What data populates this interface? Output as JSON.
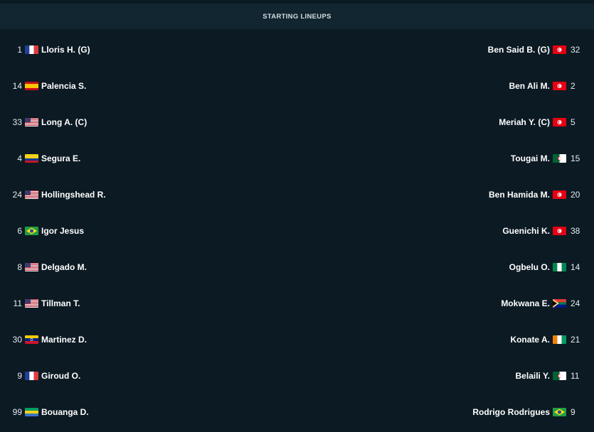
{
  "header": {
    "title": "STARTING LINEUPS"
  },
  "lineups": {
    "home": [
      {
        "number": "1",
        "name": "Lloris H. (G)",
        "flag": "france"
      },
      {
        "number": "14",
        "name": "Palencia S.",
        "flag": "spain"
      },
      {
        "number": "33",
        "name": "Long A. (C)",
        "flag": "usa"
      },
      {
        "number": "4",
        "name": "Segura E.",
        "flag": "colombia"
      },
      {
        "number": "24",
        "name": "Hollingshead R.",
        "flag": "usa"
      },
      {
        "number": "6",
        "name": "Igor Jesus",
        "flag": "brazil"
      },
      {
        "number": "8",
        "name": "Delgado M.",
        "flag": "usa"
      },
      {
        "number": "11",
        "name": "Tillman T.",
        "flag": "usa"
      },
      {
        "number": "30",
        "name": "Martinez D.",
        "flag": "venezuela"
      },
      {
        "number": "9",
        "name": "Giroud O.",
        "flag": "france"
      },
      {
        "number": "99",
        "name": "Bouanga D.",
        "flag": "gabon"
      }
    ],
    "away": [
      {
        "number": "32",
        "name": "Ben Said B. (G)",
        "flag": "tunisia"
      },
      {
        "number": "2",
        "name": "Ben Ali M.",
        "flag": "tunisia"
      },
      {
        "number": "5",
        "name": "Meriah Y. (C)",
        "flag": "tunisia"
      },
      {
        "number": "15",
        "name": "Tougai M.",
        "flag": "algeria"
      },
      {
        "number": "20",
        "name": "Ben Hamida M.",
        "flag": "tunisia"
      },
      {
        "number": "38",
        "name": "Guenichi K.",
        "flag": "tunisia"
      },
      {
        "number": "14",
        "name": "Ogbelu O.",
        "flag": "nigeria"
      },
      {
        "number": "24",
        "name": "Mokwana E.",
        "flag": "south-africa"
      },
      {
        "number": "21",
        "name": "Konate A.",
        "flag": "ivory-coast"
      },
      {
        "number": "11",
        "name": "Belaili Y.",
        "flag": "algeria"
      },
      {
        "number": "9",
        "name": "Rodrigo Rodrigues",
        "flag": "brazil"
      }
    ]
  },
  "colors": {
    "background": "#0c1a23",
    "header_bg": "#112630",
    "text": "#ffffff"
  }
}
